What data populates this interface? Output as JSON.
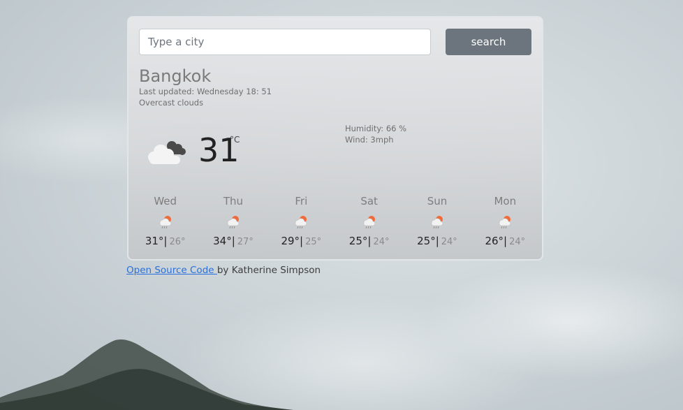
{
  "search": {
    "placeholder": "Type a city",
    "button_label": "search"
  },
  "current": {
    "city": "Bangkok",
    "last_updated": "Last updated: Wednesday 18: 51",
    "description": "Overcast clouds",
    "temperature": "31",
    "unit": "°C",
    "icon": "cloud-icon",
    "humidity": "Humidity: 66 %",
    "wind": "Wind: 3mph"
  },
  "forecast": [
    {
      "day": "Wed",
      "high": "31°|",
      "low": "26°",
      "icon": "rain-sun-icon"
    },
    {
      "day": "Thu",
      "high": "34°|",
      "low": "27°",
      "icon": "rain-sun-icon"
    },
    {
      "day": "Fri",
      "high": "29°|",
      "low": "25°",
      "icon": "rain-sun-icon"
    },
    {
      "day": "Sat",
      "high": "25°|",
      "low": "24°",
      "icon": "rain-sun-icon"
    },
    {
      "day": "Sun",
      "high": "25°|",
      "low": "24°",
      "icon": "rain-sun-icon"
    },
    {
      "day": "Mon",
      "high": "26°|",
      "low": "24°",
      "icon": "rain-sun-icon"
    }
  ],
  "footer": {
    "link_text": "Open Source Code ",
    "author": "by Katherine Simpson"
  },
  "colors": {
    "button": "#6c757d",
    "link": "#2a6fdb",
    "sun": "#f06a3a"
  }
}
